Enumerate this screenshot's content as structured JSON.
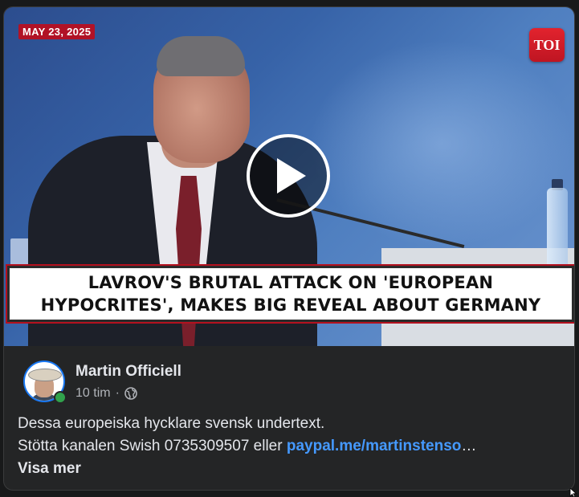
{
  "video": {
    "date_badge": "MAY 23, 2025",
    "logo_text": "TOI",
    "headline_line1": "LAVROV'S BRUTAL ATTACK ON 'EUROPEAN",
    "headline_line2": "HYPOCRITES', MAKES BIG REVEAL ABOUT GERMANY"
  },
  "post": {
    "author": "Martin Officiell",
    "time": "10 tim",
    "separator": "·",
    "privacy_icon": "globe-icon",
    "text_line1": "Dessa europeiska hycklare svensk undertext.",
    "text_line2_prefix": "Stötta kanalen Swish 0735309507 eller ",
    "link_text": "paypal.me/martinstenso",
    "ellipsis": "…",
    "see_more": "Visa mer"
  },
  "colors": {
    "background": "#18191a",
    "card": "#242526",
    "link": "#4599ff",
    "online": "#31a24c",
    "date_badge": "#b11226",
    "toi_red": "#e2232e"
  }
}
